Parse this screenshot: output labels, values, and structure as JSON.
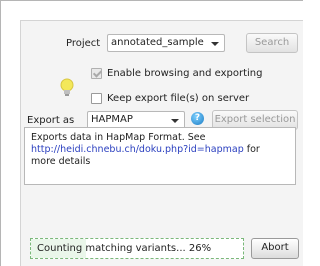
{
  "project": {
    "label": "Project",
    "selected": "annotated_sample",
    "search_label": "Search"
  },
  "options": {
    "enable_browsing_label": "Enable browsing and exporting",
    "enable_browsing_checked": true,
    "keep_files_label": "Keep export file(s) on server",
    "keep_files_checked": false
  },
  "export": {
    "label": "Export as",
    "format": "HAPMAP",
    "help_glyph": "?",
    "export_selection_label": "Export selection"
  },
  "description": {
    "text": "Exports data in HapMap Format. See",
    "link": "http://heidi.chnebu.ch/doku.php?id=hapmap",
    "link_suffix": " for",
    "more": "more details"
  },
  "progress": {
    "text": "Counting matching variants... 26%",
    "percent": 26,
    "abort_label": "Abort"
  },
  "icons": {
    "bulb": "lightbulb-icon",
    "help": "help-icon",
    "dropdown": "chevron-down-icon"
  },
  "colors": {
    "link": "#2a3fbf",
    "progress_border": "#7ab87a",
    "help_icon": "#1a7bc4",
    "bulb": "#f3e85a"
  }
}
